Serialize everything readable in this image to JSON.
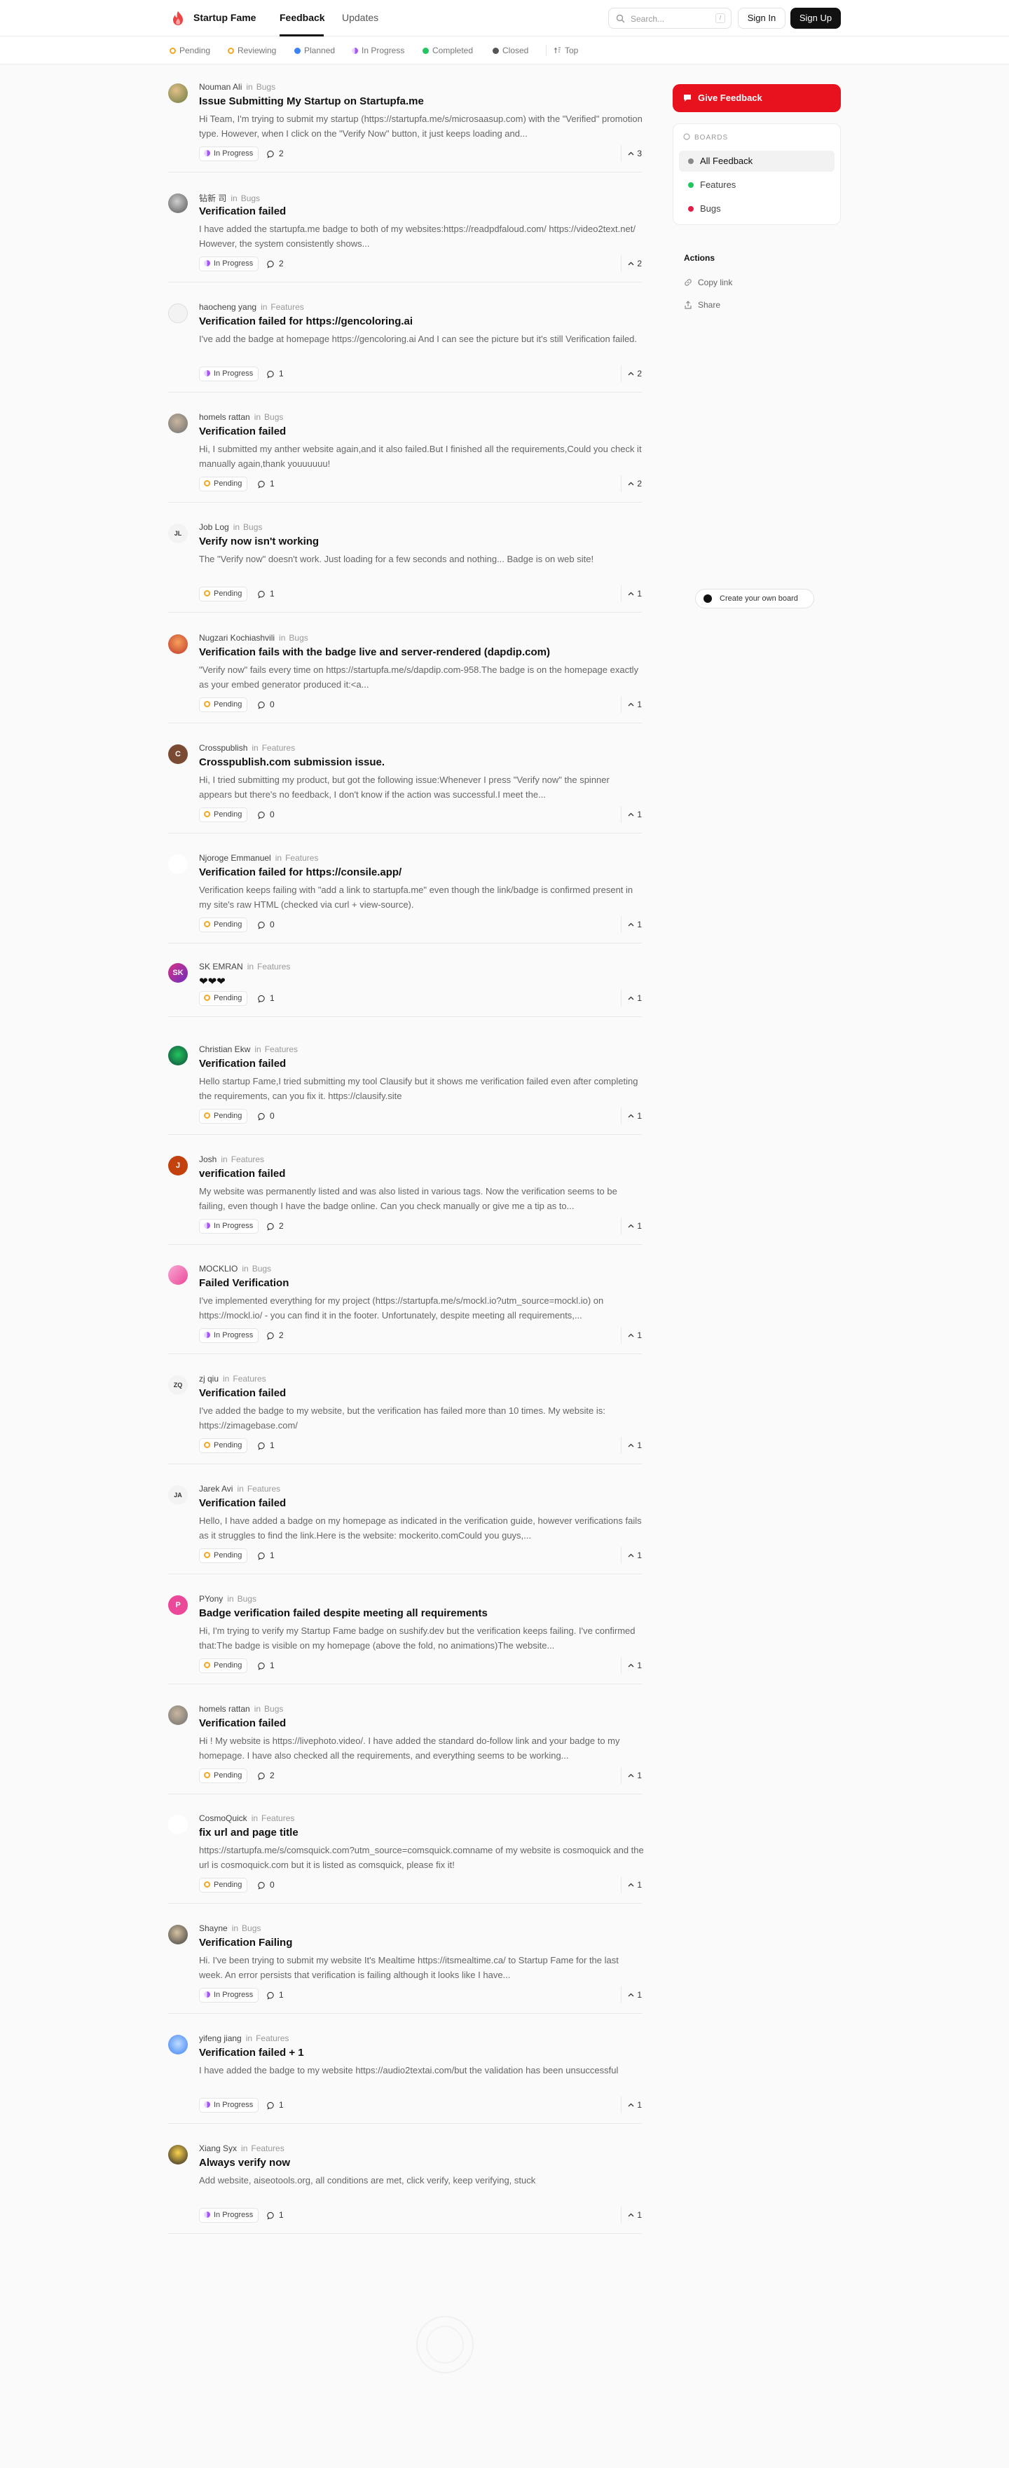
{
  "header": {
    "brand": "Startup Fame",
    "nav": {
      "feedback": "Feedback",
      "updates": "Updates"
    },
    "search_placeholder": "Search...",
    "search_shortcut": "/",
    "sign_in": "Sign In",
    "sign_up": "Sign Up"
  },
  "filters": [
    {
      "label": "Pending",
      "color": "#f5a623"
    },
    {
      "label": "Reviewing",
      "color": "#f5a623"
    },
    {
      "label": "Planned",
      "color": "#3b82f6"
    },
    {
      "label": "In Progress",
      "color": "#a855f7"
    },
    {
      "label": "Completed",
      "color": "#22c55e"
    },
    {
      "label": "Closed",
      "color": "#555555"
    },
    {
      "label": "Top",
      "icon": "top-sort-icon"
    }
  ],
  "posts": [
    {
      "author": "Nouman Ali",
      "in": "in",
      "board": "Bugs",
      "title": "Issue Submitting My Startup on Startupfa.me",
      "desc": "Hi Team, I'm trying to submit my startup (https://startupfa.me/s/microsaasup.com) with the \"Verified\" promotion type. However, when I click on the \"Verify Now\" button, it just keeps loading and...",
      "status": "In Progress",
      "comments": "2",
      "votes": "3"
    },
    {
      "author": "钻新 司",
      "in": "in",
      "board": "Bugs",
      "title": "Verification failed",
      "desc": "I have added the startupfa.me badge to both of my websites:https://readpdfaloud.com/ https://video2text.net/ However, the system consistently shows...",
      "status": "In Progress",
      "comments": "2",
      "votes": "2"
    },
    {
      "author": "haocheng yang",
      "in": "in",
      "board": "Features",
      "title": "Verification failed for https://gencoloring.ai",
      "desc": "I've add the badge at homepage https://gencoloring.ai  And I can see the picture but it's still Verification failed.",
      "status": "In Progress",
      "comments": "1",
      "votes": "2"
    },
    {
      "author": "homels rattan",
      "in": "in",
      "board": "Bugs",
      "title": "Verification failed",
      "desc": "Hi, I submitted my anther website again,and it also failed.But I finished all the requirements,Could you check it manually again,thank youuuuuu!",
      "status": "Pending",
      "comments": "1",
      "votes": "2"
    },
    {
      "author": "Job Log",
      "in": "in",
      "board": "Bugs",
      "title": "Verify now isn't working",
      "desc": "The \"Verify now\" doesn't work. Just loading for a few seconds and nothing... Badge is on web site!",
      "status": "Pending",
      "comments": "1",
      "votes": "1"
    },
    {
      "author": "Nugzari Kochiashvili",
      "in": "in",
      "board": "Bugs",
      "title": "Verification fails with the badge live and server-rendered (dapdip.com)",
      "desc": "\"Verify now\" fails every time on https://startupfa.me/s/dapdip.com-958.The badge is on the homepage exactly as your embed generator produced it:<a...",
      "status": "Pending",
      "comments": "0",
      "votes": "1"
    },
    {
      "author": "Crosspublish",
      "in": "in",
      "board": "Features",
      "title": "Crosspublish.com submission issue.",
      "desc": "Hi, I tried submitting my product, but got the following issue:Whenever I press \"Verify now\" the spinner appears but there's no feedback, I don't know if the action was successful.I meet the...",
      "status": "Pending",
      "comments": "0",
      "votes": "1"
    },
    {
      "author": "Njoroge Emmanuel",
      "in": "in",
      "board": "Features",
      "title": "Verification failed for https://consile.app/",
      "desc": "Verification keeps failing with \"add a link to startupfa.me\" even though the link/badge is confirmed present in my site's raw HTML (checked via curl + view-source).",
      "status": "Pending",
      "comments": "0",
      "votes": "1"
    },
    {
      "author": "SK EMRAN",
      "in": "in",
      "board": "Features",
      "title": "❤❤❤",
      "desc": "",
      "status": "Pending",
      "comments": "1",
      "votes": "1"
    },
    {
      "author": "Christian Ekw",
      "in": "in",
      "board": "Features",
      "title": "Verification failed",
      "desc": "Hello startup Fame,I tried submitting my tool Clausify but it shows me verification failed even after completing the requirements, can you fix it.  https://clausify.site",
      "status": "Pending",
      "comments": "0",
      "votes": "1"
    },
    {
      "author": "Josh",
      "in": "in",
      "board": "Features",
      "title": "verification failed",
      "desc": "My website was permanently listed and was also listed in various tags. Now the verification seems to be failing, even though I have the badge online. Can you check manually or give me a tip as to...",
      "status": "In Progress",
      "comments": "2",
      "votes": "1"
    },
    {
      "author": "MOCKLIO",
      "in": "in",
      "board": "Bugs",
      "title": "Failed Verification",
      "desc": "I've implemented everything for my project (https://startupfa.me/s/mockl.io?utm_source=mockl.io) on https://mockl.io/ - you can find it in the footer. Unfortunately, despite meeting all requirements,...",
      "status": "In Progress",
      "comments": "2",
      "votes": "1"
    },
    {
      "author": "zj qiu",
      "in": "in",
      "board": "Features",
      "title": "Verification failed",
      "desc": "I've added the badge to my website, but the verification has failed more than 10 times. My website is: https://zimagebase.com/",
      "status": "Pending",
      "comments": "1",
      "votes": "1"
    },
    {
      "author": "Jarek Avi",
      "in": "in",
      "board": "Features",
      "title": "Verification failed",
      "desc": "Hello, I have added a badge on my homepage as indicated in the verification guide, however verifications fails as it struggles to find the link.Here is the website: mockerito.comCould you guys,...",
      "status": "Pending",
      "comments": "1",
      "votes": "1"
    },
    {
      "author": "PYony",
      "in": "in",
      "board": "Bugs",
      "title": "Badge verification failed despite meeting all requirements",
      "desc": "Hi, I'm trying to verify my Startup Fame badge on sushify.dev but the verification keeps failing. I've confirmed that:The badge is visible on my homepage (above the fold, no animations)The website...",
      "status": "Pending",
      "comments": "1",
      "votes": "1"
    },
    {
      "author": "homels rattan",
      "in": "in",
      "board": "Bugs",
      "title": "Verification failed",
      "desc": "Hi  ! My website is https://livephoto.video/. I have added the standard do-follow link and your badge to my homepage. I have also checked all the requirements, and everything seems to be working...",
      "status": "Pending",
      "comments": "2",
      "votes": "1"
    },
    {
      "author": "CosmoQuick",
      "in": "in",
      "board": "Features",
      "title": "fix url and page title",
      "desc": "https://startupfa.me/s/comsquick.com?utm_source=comsquick.comname of my website is cosmoquick and the url is cosmoquick.com but it is listed as comsquick, please fix it!",
      "status": "Pending",
      "comments": "0",
      "votes": "1"
    },
    {
      "author": "Shayne",
      "in": "in",
      "board": "Bugs",
      "title": "Verification Failing",
      "desc": "Hi. I've been trying to submit my website It's Mealtime https://itsmealtime.ca/  to Startup Fame for the last week. An error persists that verification is failing although it looks like I have...",
      "status": "In Progress",
      "comments": "1",
      "votes": "1"
    },
    {
      "author": "yifeng jiang",
      "in": "in",
      "board": "Features",
      "title": "Verification failed + 1",
      "desc": "I have added the badge to my website https://audio2textai.com/but the validation has been unsuccessful",
      "status": "In Progress",
      "comments": "1",
      "votes": "1"
    },
    {
      "author": "Xiang Syx",
      "in": "in",
      "board": "Features",
      "title": "Always verify now",
      "desc": "Add website, aiseotools.org, all conditions are met, click verify, keep verifying, stuck",
      "status": "In Progress",
      "comments": "1",
      "votes": "1"
    }
  ],
  "sidebar": {
    "give_feedback": "Give Feedback",
    "boards_heading": "BOARDS",
    "boards": [
      {
        "label": "All Feedback",
        "color": "#888888"
      },
      {
        "label": "Features",
        "color": "#22c55e"
      },
      {
        "label": "Bugs",
        "color": "#e11d48"
      }
    ],
    "actions_title": "Actions",
    "actions": [
      {
        "label": "Copy link",
        "icon": "link-icon"
      },
      {
        "label": "Share",
        "icon": "share-icon"
      }
    ],
    "create_board": "Create your own board"
  },
  "status_colors": {
    "In Progress": "#a855f7",
    "Pending": "#f5a623"
  },
  "accent": "#e8111e"
}
